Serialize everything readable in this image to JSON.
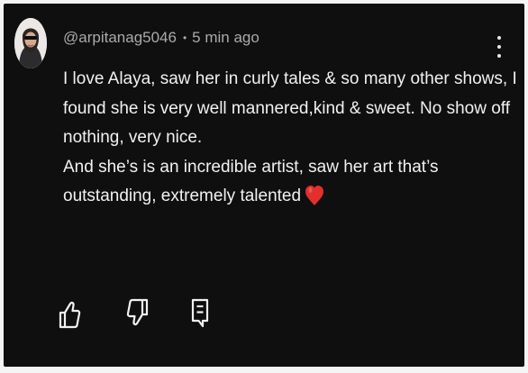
{
  "comment": {
    "author_handle": "@arpitanag5046",
    "separator": "•",
    "timestamp": "5 min ago",
    "lines": [
      "I love Alaya, saw her in curly tales & so many other shows, I",
      "found she is very well mannered,kind & sweet. No show off",
      "nothing, very nice.",
      "And she’s is an incredible artist, saw her art that’s",
      "outstanding, extremely talented"
    ],
    "trailing_emoji": "red-heart-icon"
  },
  "icons": {
    "avatar": "avatar-photo",
    "more": "vertical-ellipsis-icon",
    "like": "thumbs-up-icon",
    "dislike": "thumbs-down-icon",
    "reply": "reply-comment-icon"
  },
  "colors": {
    "background": "#0f0f0f",
    "text": "#f1f1f1",
    "meta_text": "#aaaaaa",
    "heart": "#e2302c"
  }
}
